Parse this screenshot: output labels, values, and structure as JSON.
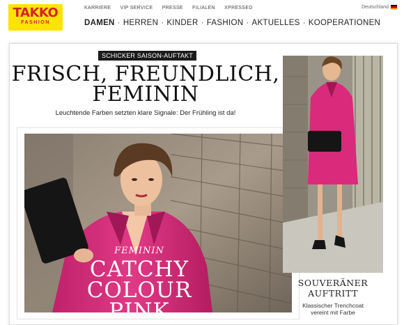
{
  "brand": {
    "logo_line1": "TAKKO",
    "logo_line2": "FASHION",
    "logo_bg": "#fce300",
    "logo_fg": "#d8202a"
  },
  "meta_nav": [
    "KARRIERE",
    "VIP SERVICE",
    "PRESSE",
    "FILIALEN",
    "XPRESSED"
  ],
  "language": "Deutschland",
  "main_nav": [
    {
      "label": "DAMEN",
      "active": true
    },
    {
      "label": "HERREN",
      "active": false
    },
    {
      "label": "KINDER",
      "active": false
    },
    {
      "label": "FASHION",
      "active": false
    },
    {
      "label": "AKTUELLES",
      "active": false
    },
    {
      "label": "KOOPERATIONEN",
      "active": false
    }
  ],
  "nav_separator": "·",
  "teaser": {
    "kicker": "SCHICKER SAISON-AUFTAKT",
    "headline_line1": "FRISCH, FREUNDLICH,",
    "headline_line2": "FEMININ",
    "subline": "Leuchtende Farben setzten klare Signale: Der Frühling ist da!"
  },
  "hero": {
    "caption_small": "FEMININ",
    "caption_line1": "CATCHY COLOUR",
    "caption_line2": "PINK",
    "accent": "#d92a7c"
  },
  "side_teaser": {
    "title_line1": "SOUVERÄNER",
    "title_line2": "AUFTRITT",
    "sub_line1": "Klassischer Trenchcoat",
    "sub_line2": "vereint mit Farbe"
  },
  "icons": {
    "flag": "germany-flag-icon"
  }
}
